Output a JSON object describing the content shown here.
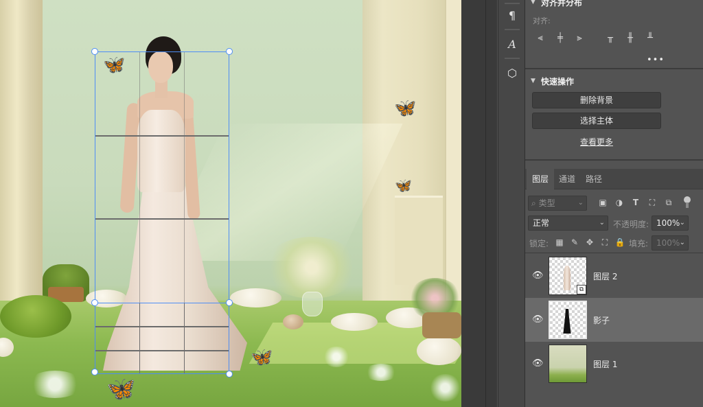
{
  "tools": {
    "paragraph_icon": "pilcrow-icon",
    "glyphs_icon": "glyphs-icon",
    "three_d_icon": "3d-cube-icon"
  },
  "align_panel": {
    "title": "对齐并分布",
    "align_label": "对齐:",
    "icons": [
      "align-left-icon",
      "align-center-horizontal-icon",
      "align-right-icon",
      "align-top-icon",
      "align-center-vertical-icon",
      "align-bottom-icon"
    ],
    "more": "•••"
  },
  "quick_actions": {
    "title": "快速操作",
    "remove_background": "删除背景",
    "select_subject": "选择主体",
    "view_more": "查看更多"
  },
  "layers_panel": {
    "tabs": [
      {
        "label": "图层",
        "active": true
      },
      {
        "label": "通道",
        "active": false
      },
      {
        "label": "路径",
        "active": false
      }
    ],
    "filter": {
      "placeholder": "类型",
      "icons": [
        "image-filter-icon",
        "adjustment-filter-icon",
        "type-filter-icon",
        "shape-filter-icon",
        "smart-object-filter-icon"
      ]
    },
    "blend_mode": "正常",
    "opacity_label": "不透明度:",
    "opacity_value": "100%",
    "lock_label": "锁定:",
    "lock_icons": [
      "lock-transparency-icon",
      "lock-image-icon",
      "lock-position-icon",
      "lock-artboard-icon",
      "lock-all-icon"
    ],
    "fill_label": "填充:",
    "fill_value": "100%",
    "layers": [
      {
        "name": "图层 2",
        "visible": true,
        "selected": false,
        "thumb": "woman-cutout",
        "smart_object": true
      },
      {
        "name": "影子",
        "visible": true,
        "selected": true,
        "thumb": "shadow-silhouette",
        "smart_object": false
      },
      {
        "name": "图层 1",
        "visible": true,
        "selected": false,
        "thumb": "room-photo",
        "smart_object": false
      }
    ]
  },
  "colors": {
    "selection_accent": "#4d8df5",
    "panel_bg": "#535353",
    "selected_layer_bg": "#6a6a6a"
  }
}
